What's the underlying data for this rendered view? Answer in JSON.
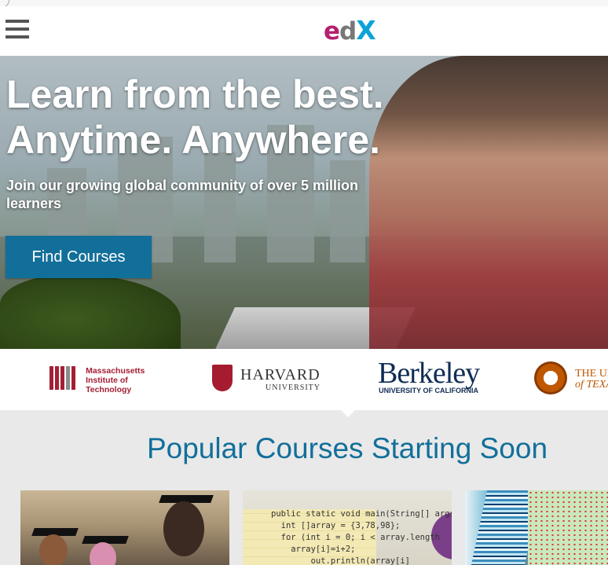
{
  "header": {
    "menu_icon": "hamburger-menu-icon",
    "logo": {
      "e": "e",
      "d": "d",
      "x": "X"
    }
  },
  "hero": {
    "headline_line1": "Learn from the best.",
    "headline_line2": "Anytime. Anywhere.",
    "subtitle": "Join our growing global community of over 5 million learners",
    "cta_label": "Find Courses"
  },
  "partners": {
    "mit": {
      "line1": "Massachusetts",
      "line2": "Institute of",
      "line3": "Technology"
    },
    "harvard": {
      "line1": "HARVARD",
      "line2": "UNIVERSITY"
    },
    "berkeley": {
      "line1": "Berkeley",
      "line2": "UNIVERSITY OF CALIFORNIA"
    },
    "texas": {
      "line1": "THE UN",
      "line2": "of TEXA"
    }
  },
  "popular": {
    "title": "Popular Courses Starting Soon",
    "code_lines": [
      "public static void main(String[] args) {",
      "  int []array = {3,78,98};",
      "  for (int i = 0; i < array.length",
      "    array[i]=i+2;",
      "        out.println(array[i]"
    ]
  },
  "colors": {
    "brand_blue": "#126f9a",
    "mit_red": "#a31f34",
    "harvard_crimson": "#a51c30",
    "berkeley_navy": "#0f2c55",
    "texas_orange": "#bf5700"
  }
}
